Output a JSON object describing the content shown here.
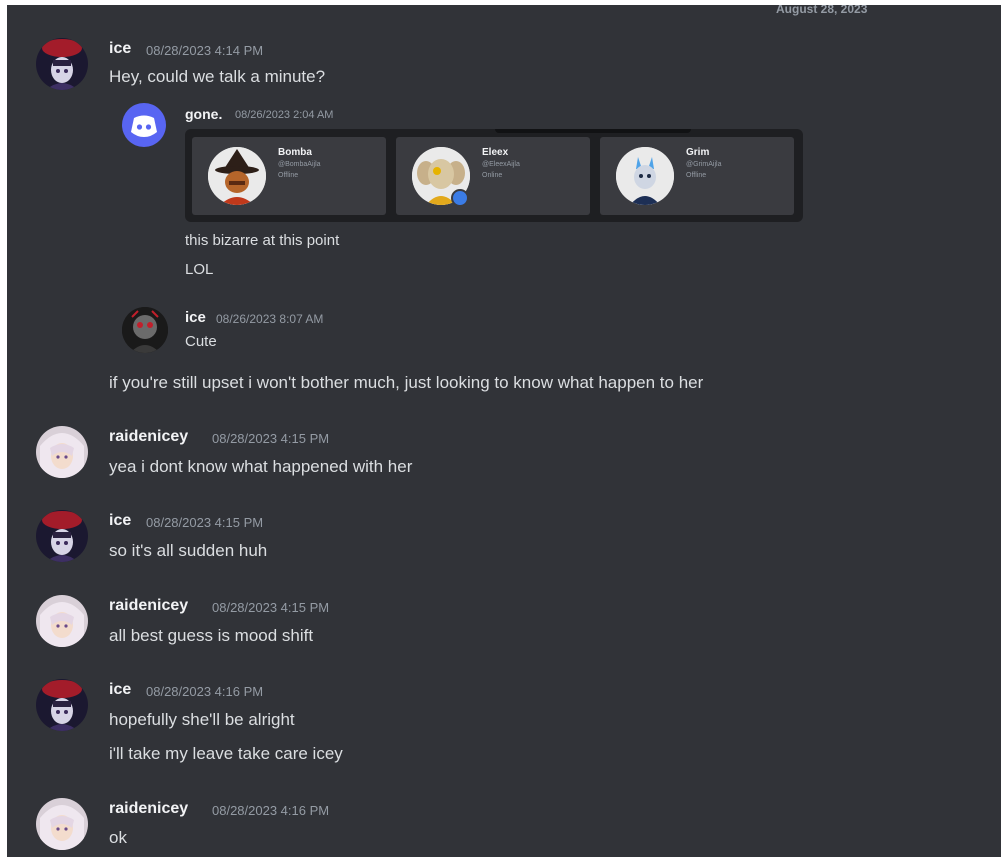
{
  "date_divider": "August 28, 2023",
  "messages": [
    {
      "author": "ice",
      "timestamp": "08/28/2023 4:14 PM",
      "lines": [
        "Hey, could we talk a minute?"
      ]
    },
    {
      "author": "raidenicey",
      "timestamp": "08/28/2023 4:15 PM",
      "lines": [
        "yea i dont know what happened with her"
      ]
    },
    {
      "author": "ice",
      "timestamp": "08/28/2023 4:15 PM",
      "lines": [
        "so it's all sudden huh"
      ]
    },
    {
      "author": "raidenicey",
      "timestamp": "08/28/2023 4:15 PM",
      "lines": [
        "all best guess is mood shift"
      ]
    },
    {
      "author": "ice",
      "timestamp": "08/28/2023 4:16 PM",
      "lines": [
        "hopefully she'll be alright",
        "i'll take my leave take care icey"
      ]
    },
    {
      "author": "raidenicey",
      "timestamp": "08/28/2023 4:16 PM",
      "lines": [
        "ok"
      ]
    }
  ],
  "forwarded": {
    "author": "gone.",
    "timestamp": "08/26/2023 2:04 AM",
    "cards": [
      {
        "name": "Bomba",
        "handle": "@BombaAijla",
        "status": "Offline"
      },
      {
        "name": "Eleex",
        "handle": "@EleexAijla",
        "status": "Online"
      },
      {
        "name": "Grim",
        "handle": "@GrimAijla",
        "status": "Offline"
      }
    ],
    "lines": [
      "this bizarre at this point",
      "LOL"
    ]
  },
  "quoted": {
    "author": "ice",
    "timestamp": "08/26/2023 8:07 AM",
    "text": "Cute"
  },
  "continuation": "if you're still upset i won't bother much, just looking to know what happen to her",
  "colors": {
    "background": "#313338",
    "discord_blurple": "#5865f2",
    "text": "#dbdee1",
    "muted": "#949ba4"
  },
  "icons": [
    "discord-logo-icon",
    "user-avatar-icon"
  ]
}
